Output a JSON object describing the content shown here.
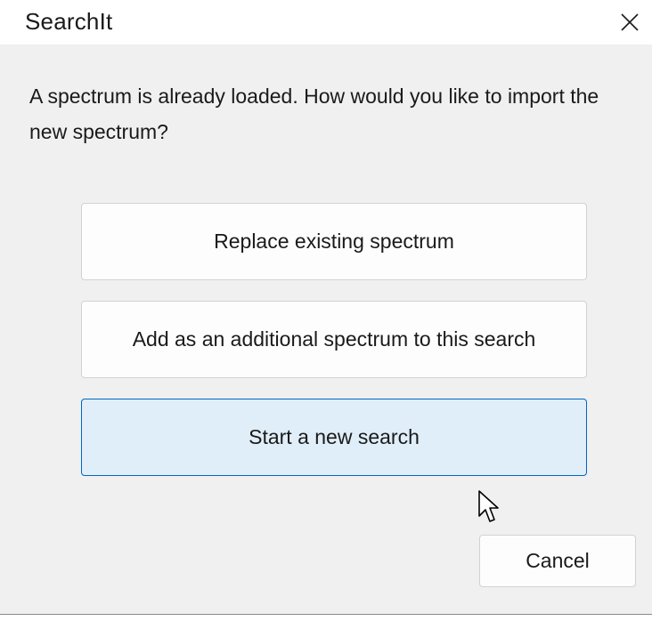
{
  "window": {
    "title": "SearchIt"
  },
  "dialog": {
    "message": "A spectrum is already loaded.  How would you like to import the new spectrum?",
    "options": [
      {
        "label": "Replace existing spectrum",
        "selected": false
      },
      {
        "label": "Add as an additional spectrum to this search",
        "selected": false
      },
      {
        "label": "Start a new search",
        "selected": true
      }
    ],
    "cancel_label": "Cancel"
  },
  "icons": {
    "close": "close-icon",
    "cursor": "mouse-pointer-icon"
  },
  "colors": {
    "body_bg": "#f0f0f0",
    "selected_bg": "#e0eef9",
    "selected_border": "#0067c0"
  }
}
